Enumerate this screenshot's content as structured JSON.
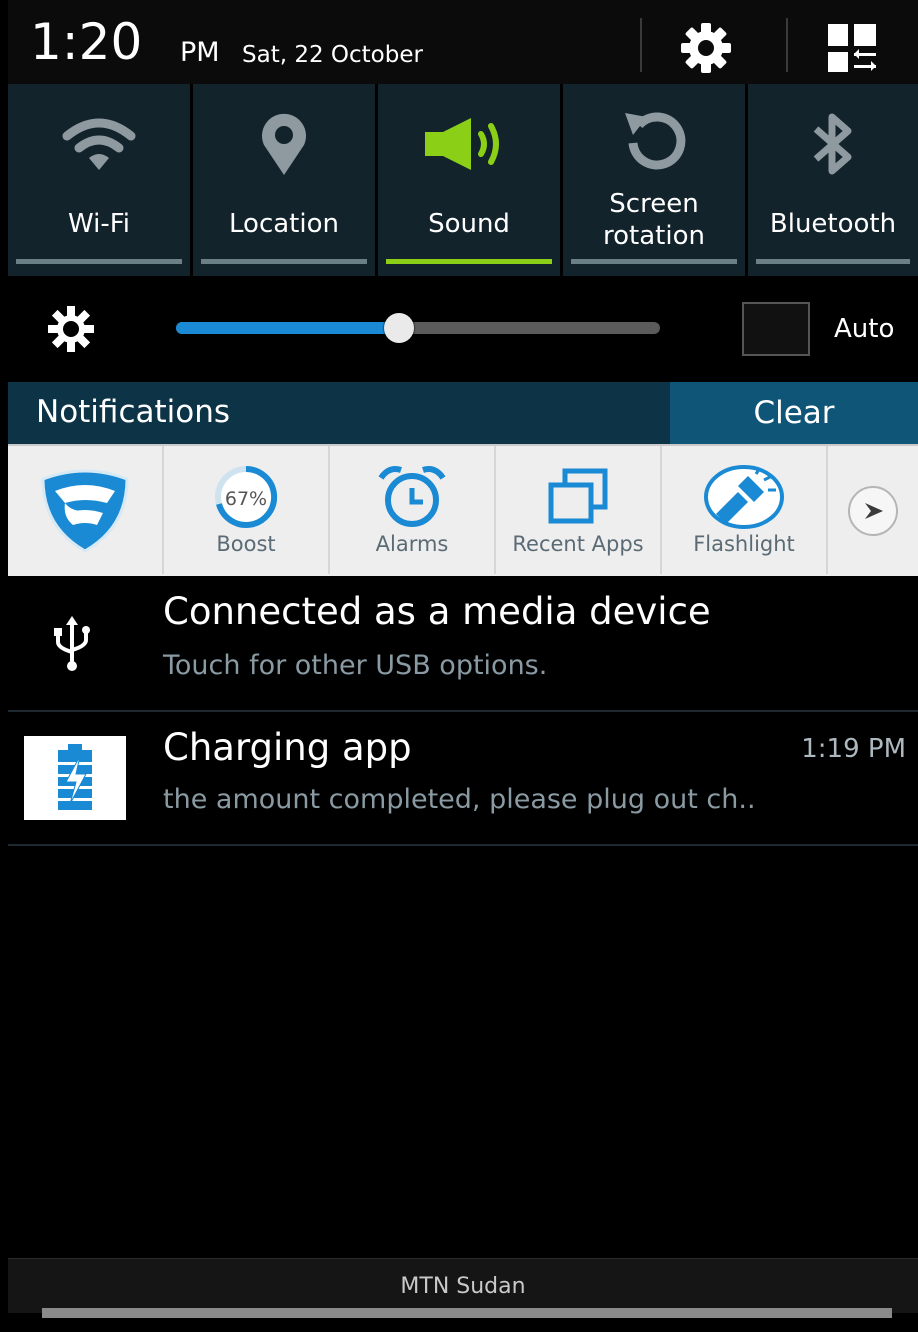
{
  "status": {
    "time": "1:20",
    "ampm": "PM",
    "date": "Sat, 22 October"
  },
  "toggles": [
    {
      "label": "Wi-Fi",
      "icon": "wifi-icon",
      "on": false
    },
    {
      "label": "Location",
      "icon": "location-pin-icon",
      "on": false
    },
    {
      "label": "Sound",
      "icon": "speaker-icon",
      "on": true
    },
    {
      "label": "Screen rotation",
      "icon": "rotation-icon",
      "on": false
    },
    {
      "label": "Bluetooth",
      "icon": "bluetooth-icon",
      "on": false
    }
  ],
  "brightness": {
    "level": 0.46,
    "auto_label": "Auto",
    "auto_checked": false
  },
  "notifications": {
    "header": "Notifications",
    "clear_label": "Clear"
  },
  "shortcuts": {
    "boost_percent": "67%",
    "items": [
      {
        "label": "",
        "icon": "shield-icon"
      },
      {
        "label": "Boost",
        "icon": "boost-gauge-icon"
      },
      {
        "label": "Alarms",
        "icon": "alarm-clock-icon"
      },
      {
        "label": "Recent Apps",
        "icon": "recent-apps-icon"
      },
      {
        "label": "Flashlight",
        "icon": "flashlight-icon"
      }
    ]
  },
  "notification_items": [
    {
      "title": "Connected as a media device",
      "subtitle": "Touch for other USB options.",
      "time": "",
      "icon": "usb-icon"
    },
    {
      "title": "Charging app",
      "subtitle": "the amount completed, please plug out ch..",
      "time": "1:19 PM",
      "icon": "battery-charging-icon"
    }
  ],
  "carrier": "MTN Sudan",
  "colors": {
    "accent_green": "#8bd016",
    "accent_blue": "#1a8ad4",
    "header_bg": "#0d3347",
    "clear_bg": "#0e5577"
  }
}
